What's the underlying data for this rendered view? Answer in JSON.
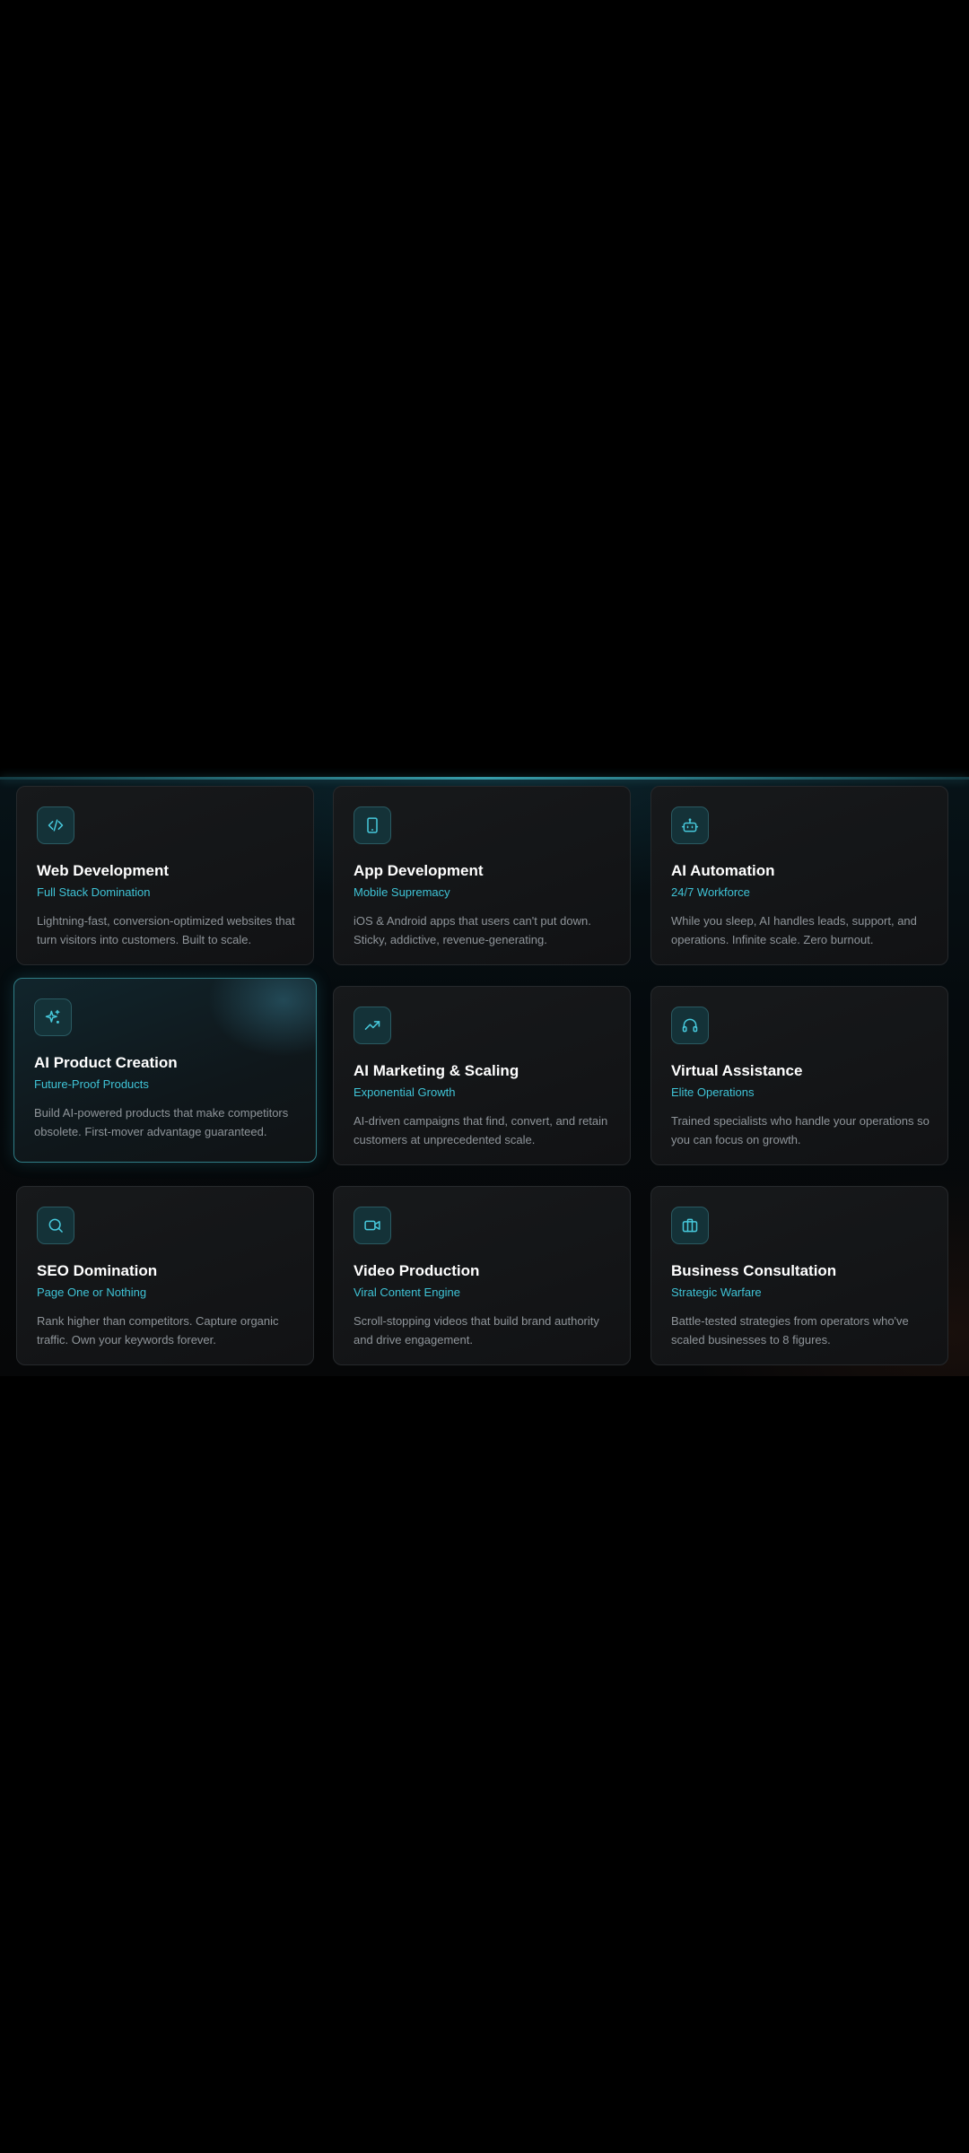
{
  "colors": {
    "accent": "#47c9dc",
    "subtitle": "#3fc3d6",
    "title": "#ffffff",
    "description": "#8f959a",
    "card_background": "#141618",
    "highlight_border": "#2f7d86"
  },
  "services": [
    {
      "icon": "code-icon",
      "title": "Web Development",
      "subtitle": "Full Stack Domination",
      "description": "Lightning-fast, conversion-optimized websites that turn visitors into customers. Built to scale."
    },
    {
      "icon": "smartphone-icon",
      "title": "App Development",
      "subtitle": "Mobile Supremacy",
      "description": "iOS & Android apps that users can't put down. Sticky, addictive, revenue-generating."
    },
    {
      "icon": "bot-icon",
      "title": "AI Automation",
      "subtitle": "24/7 Workforce",
      "description": "While you sleep, AI handles leads, support, and operations. Infinite scale. Zero burnout."
    },
    {
      "icon": "sparkles-icon",
      "title": "AI Product Creation",
      "subtitle": "Future-Proof Products",
      "description": "Build AI-powered products that make competitors obsolete. First-mover advantage guaranteed."
    },
    {
      "icon": "trending-up-icon",
      "title": "AI Marketing & Scaling",
      "subtitle": "Exponential Growth",
      "description": "AI-driven campaigns that find, convert, and retain customers at unprecedented scale."
    },
    {
      "icon": "headphones-icon",
      "title": "Virtual Assistance",
      "subtitle": "Elite Operations",
      "description": "Trained specialists who handle your operations so you can focus on growth."
    },
    {
      "icon": "search-icon",
      "title": "SEO Domination",
      "subtitle": "Page One or Nothing",
      "description": "Rank higher than competitors. Capture organic traffic. Own your keywords forever."
    },
    {
      "icon": "video-icon",
      "title": "Video Production",
      "subtitle": "Viral Content Engine",
      "description": "Scroll-stopping videos that build brand authority and drive engagement."
    },
    {
      "icon": "briefcase-icon",
      "title": "Business Consultation",
      "subtitle": "Strategic Warfare",
      "description": "Battle-tested strategies from operators who've scaled businesses to 8 figures."
    }
  ]
}
